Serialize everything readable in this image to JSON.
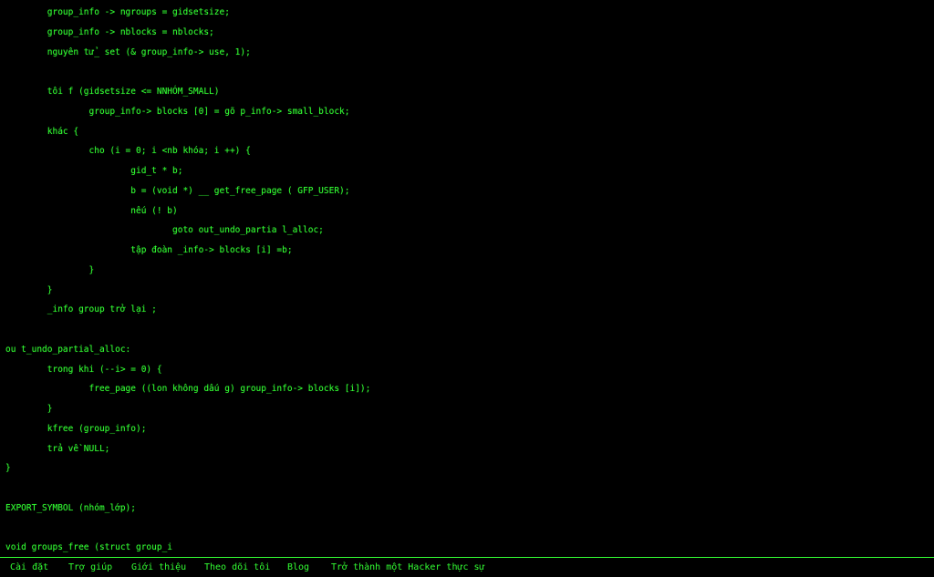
{
  "colors": {
    "background": "#000000",
    "text": "#33ff33"
  },
  "code_lines": [
    "        group_info -> ngroups = gidsetsize;",
    "        group_info -> nblocks = nblocks;",
    "        nguyên tử_ set (& group_info-> use, 1);",
    "",
    "        tôi f (gidsetsize <= NNHÓM_SMALL)",
    "                group_info-> blocks [0] = gõ p_info-> small_block;",
    "        khác {",
    "                cho (i = 0; i <nb khóa; i ++) {",
    "                        gid_t * b;",
    "                        b = (void *) __ get_free_page ( GFP_USER);",
    "                        nếu (! b)",
    "                                goto out_undo_partia l_alloc;",
    "                        tập đoàn _info-> blocks [i] =b;",
    "                }",
    "        }",
    "        _info group trở lại ;",
    "",
    "ou t_undo_partial_alloc:",
    "        trong khi (--i> = 0) {",
    "                free_page ((lon không dấu g) group_info-> blocks [i]);",
    "        }",
    "        kfree (group_info);",
    "        trả về NULL;",
    "}",
    "",
    "EXPORT_SYMBOL (nhóm_lớp);",
    "",
    "void groups_free (struct group_i"
  ],
  "menu": {
    "items": [
      "Cài đặt",
      "Trợ giúp",
      "Giới thiệu",
      "Theo dõi tôi",
      "Blog",
      "Trở thành một Hacker thực sự"
    ]
  }
}
